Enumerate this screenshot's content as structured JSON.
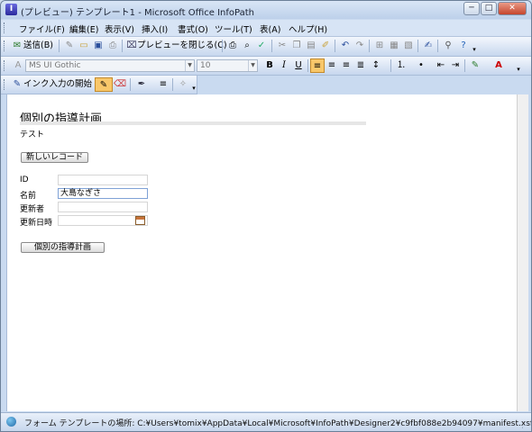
{
  "window": {
    "title": "(プレビュー) テンプレート1 - Microsoft Office InfoPath",
    "app_icon_glyph": "I",
    "minimize_glyph": "─",
    "maximize_glyph": "□",
    "close_glyph": "✕"
  },
  "menu": [
    "ファイル(F)",
    "編集(E)",
    "表示(V)",
    "挿入(I)",
    "書式(O)",
    "ツール(T)",
    "表(A)",
    "ヘルプ(H)"
  ],
  "toolbar1": {
    "send_label": "送信(B)",
    "close_preview_label": "プレビューを閉じる(C)"
  },
  "toolbar2": {
    "font_name": "MS UI Gothic",
    "font_size": "10"
  },
  "toolbar3": {
    "ink_label": "インク入力の開始"
  },
  "form": {
    "title": "個別の指導計画",
    "subtitle": "テスト",
    "new_record_button": "新しいレコード",
    "fields": [
      {
        "label": "ID",
        "value": ""
      },
      {
        "label": "名前",
        "value": "大島なぎさ"
      },
      {
        "label": "更新者",
        "value": ""
      },
      {
        "label": "更新日時",
        "value": ""
      }
    ],
    "plan_button": "個別の指導計画"
  },
  "status": {
    "text": "フォーム テンプレートの場所: C:¥Users¥tomix¥AppData¥Local¥Microsoft¥InfoPath¥Designer2¥c9fbf088e2b94097¥manifest.xsf"
  },
  "colors": {
    "accent": "#c9daf0",
    "highlight": "#f8c76a"
  }
}
